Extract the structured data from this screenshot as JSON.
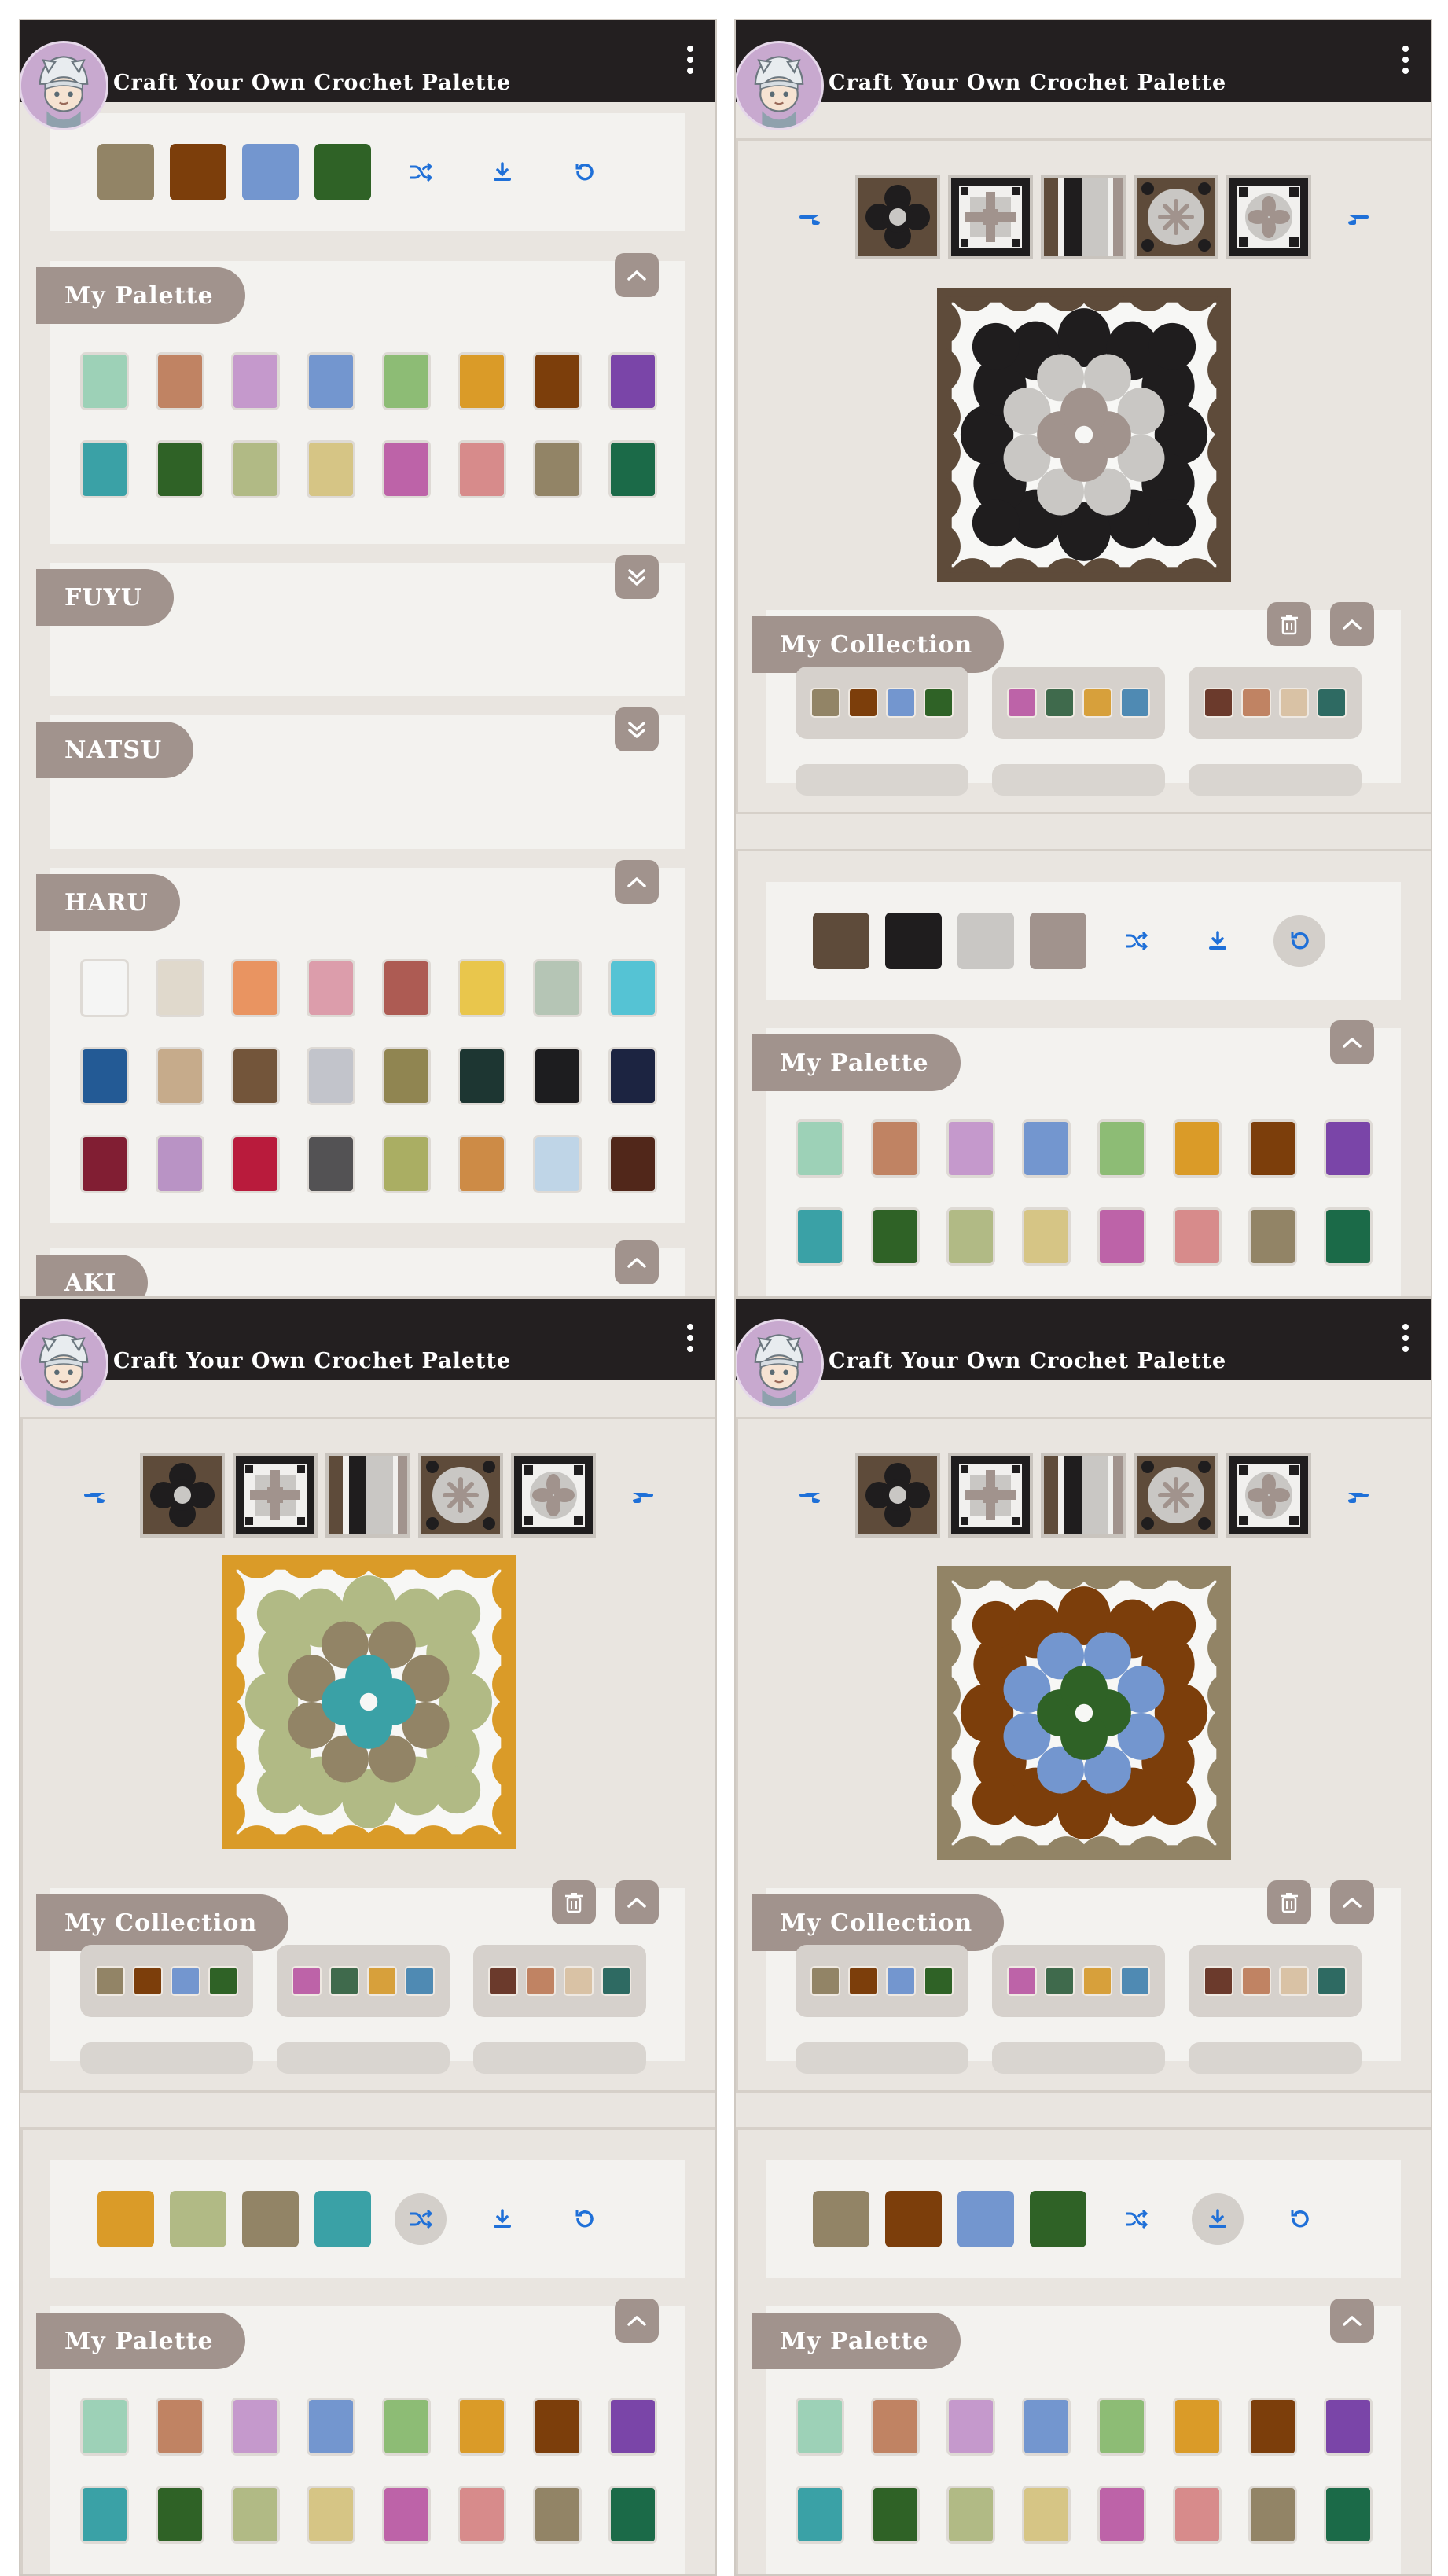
{
  "app": {
    "title": "Craft Your Own Crochet Palette"
  },
  "sections": {
    "my_palette": "My Palette",
    "my_collection": "My Collection",
    "fuyu": "FUYU",
    "natsu": "NATSU",
    "haru": "HARU",
    "aki": "AKI"
  },
  "palette_colors": [
    "#9dd1b7",
    "#c08363",
    "#c599cc",
    "#7396cf",
    "#8dbc75",
    "#da9b28",
    "#7c3e0b",
    "#7a45a8",
    "#3aa1a6",
    "#2f6226",
    "#b1ba85",
    "#d6c585",
    "#bd63a8",
    "#d78b8b",
    "#928466",
    "#1b6a48"
  ],
  "haru_colors": [
    "#f5f5f4",
    "#e0d9cc",
    "#e99461",
    "#dc9dab",
    "#ad5b53",
    "#e9c64c",
    "#b5c5b5",
    "#55c3d4",
    "#235a95",
    "#c6ab8b",
    "#73553a",
    "#c2c4cb",
    "#908551",
    "#1d3632",
    "#1d1d1f",
    "#1c2441",
    "#811e33",
    "#b993c5",
    "#b91b3c",
    "#535254",
    "#aaae63",
    "#cd8b46",
    "#bfd5e7",
    "#51271a"
  ],
  "screens": [
    {
      "current": [
        "#928466",
        "#7c3e0b",
        "#7396cf",
        "#2f6226"
      ],
      "active_btn": ""
    },
    {
      "current": [
        "#5e4b3a",
        "#1f1d1e",
        "#c9c7c4",
        "#a1938d"
      ],
      "active_btn": "reset",
      "pattern": {
        "border": "#5e4b3a",
        "outer": "#1f1d1e",
        "middle": "#c9c7c4",
        "center": "#a1938d"
      }
    },
    {
      "current": [
        "#da9b28",
        "#b1ba85",
        "#928466",
        "#3aa1a6"
      ],
      "active_btn": "shuffle",
      "pattern": {
        "border": "#da9b28",
        "outer": "#b1ba85",
        "middle": "#928466",
        "center": "#3aa1a6"
      }
    },
    {
      "current": [
        "#928466",
        "#7c3e0b",
        "#7396cf",
        "#2f6226"
      ],
      "active_btn": "download",
      "pattern": {
        "border": "#928466",
        "outer": "#7c3e0b",
        "middle": "#7396cf",
        "center": "#2f6226"
      }
    }
  ],
  "collection": [
    [
      "#928466",
      "#7c3e0b",
      "#7396cf",
      "#2f6226"
    ],
    [
      "#bd63a8",
      "#3f6a4c",
      "#d7a03b",
      "#4f8ab3"
    ],
    [
      "#6b3a2c",
      "#c08363",
      "#d9c2a5",
      "#2e6a62"
    ]
  ],
  "icons": {
    "shuffle": "shuffle-icon",
    "download": "download-icon",
    "reset": "reset-icon",
    "prev": "hand-point-left-icon",
    "next": "hand-point-right-icon",
    "delete": "trash-icon",
    "expand": "chevron-down-icon",
    "collapse": "chevron-up-icon",
    "menu": "kebab-menu-icon"
  }
}
